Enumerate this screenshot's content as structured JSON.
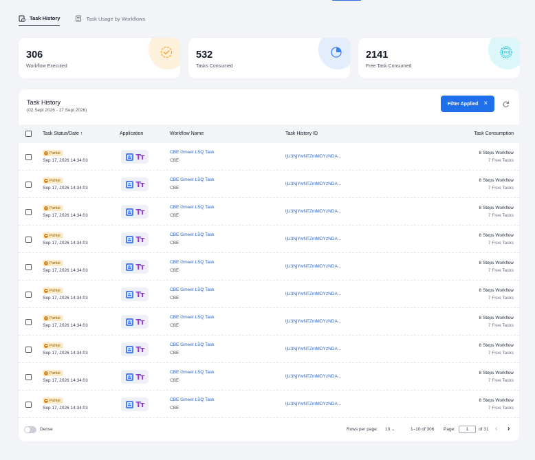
{
  "tabs": [
    {
      "label": "Task History",
      "icon": "history-icon",
      "active": true
    },
    {
      "label": "Task Usage by Workflows",
      "icon": "document-icon",
      "active": false
    }
  ],
  "kpis": [
    {
      "value": "306",
      "label": "Workflow Executed",
      "icon": "gear-check-icon",
      "color": "#f5a524"
    },
    {
      "value": "532",
      "label": "Tasks Consumed",
      "icon": "pie-chart-icon",
      "color": "#3b82f6"
    },
    {
      "value": "2141",
      "label": "Free Task Consumed",
      "icon": "free-badge-icon",
      "color": "#22c3d6"
    }
  ],
  "panel": {
    "title": "Task History",
    "subtitle": "(02 Sept 2026 - 17 Sept 2026)",
    "filter_label": "Filter Applied",
    "filter_clear": "×"
  },
  "columns": {
    "status": "Task Status/Date ↑",
    "application": "Application",
    "workflow": "Workflow Name",
    "history_id": "Task History ID",
    "consumption": "Task Consumption"
  },
  "rows": [
    {
      "status": "Partial",
      "date": "Sep 17, 2026 14:34:03",
      "app_cal": "31",
      "app_t": "Tт",
      "workflow": "CBE Gmeet LSQ Task",
      "workspace": "CBE",
      "history_id": "ljU3NjYwNTZmMDYzNDA...",
      "steps": "8 Steps Workflow",
      "free": "7 Free Tasks"
    },
    {
      "status": "Partial",
      "date": "Sep 17, 2026 14:34:03",
      "app_cal": "31",
      "app_t": "Tт",
      "workflow": "CBE Gmeet LSQ Task",
      "workspace": "CBE",
      "history_id": "ljU3NjYwNTZmMDYzNDA...",
      "steps": "8 Steps Workflow",
      "free": "7 Free Tasks"
    },
    {
      "status": "Partial",
      "date": "Sep 17, 2026 14:34:03",
      "app_cal": "31",
      "app_t": "Tт",
      "workflow": "CBE Gmeet LSQ Task",
      "workspace": "CBE",
      "history_id": "ljU3NjYwNTZmMDYzNDA...",
      "steps": "8 Steps Workflow",
      "free": "7 Free Tasks"
    },
    {
      "status": "Partial",
      "date": "Sep 17, 2026 14:34:03",
      "app_cal": "31",
      "app_t": "Tт",
      "workflow": "CBE Gmeet LSQ Task",
      "workspace": "CBE",
      "history_id": "ljU3NjYwNTZmMDYzNDA...",
      "steps": "8 Steps Workflow",
      "free": "7 Free Tasks"
    },
    {
      "status": "Partial",
      "date": "Sep 17, 2026 14:34:03",
      "app_cal": "31",
      "app_t": "Tт",
      "workflow": "CBE Gmeet LSQ Task",
      "workspace": "CBE",
      "history_id": "ljU3NjYwNTZmMDYzNDA...",
      "steps": "8 Steps Workflow",
      "free": "7 Free Tasks"
    },
    {
      "status": "Partial",
      "date": "Sep 17, 2026 14:34:03",
      "app_cal": "31",
      "app_t": "Tт",
      "workflow": "CBE Gmeet LSQ Task",
      "workspace": "CBE",
      "history_id": "ljU3NjYwNTZmMDYzNDA...",
      "steps": "8 Steps Workflow",
      "free": "7 Free Tasks"
    },
    {
      "status": "Partial",
      "date": "Sep 17, 2026 14:34:03",
      "app_cal": "31",
      "app_t": "Tт",
      "workflow": "CBE Gmeet LSQ Task",
      "workspace": "CBE",
      "history_id": "ljU3NjYwNTZmMDYzNDA...",
      "steps": "8 Steps Workflow",
      "free": "7 Free Tasks"
    },
    {
      "status": "Partial",
      "date": "Sep 17, 2026 14:34:03",
      "app_cal": "31",
      "app_t": "Tт",
      "workflow": "CBE Gmeet LSQ Task",
      "workspace": "CBE",
      "history_id": "ljU3NjYwNTZmMDYzNDA...",
      "steps": "8 Steps Workflow",
      "free": "7 Free Tasks"
    },
    {
      "status": "Partial",
      "date": "Sep 17, 2026 14:34:03",
      "app_cal": "31",
      "app_t": "Tт",
      "workflow": "CBE Gmeet LSQ Task",
      "workspace": "CBE",
      "history_id": "ljU3NjYwNTZmMDYzNDA...",
      "steps": "8 Steps Workflow",
      "free": "7 Free Tasks"
    },
    {
      "status": "Partial",
      "date": "Sep 17, 2026 14:34:03",
      "app_cal": "31",
      "app_t": "Tт",
      "workflow": "CBE Gmeet LSQ Task",
      "workspace": "CBE",
      "history_id": "ljU3NjYwNTZmMDYzNDA...",
      "steps": "8 Steps Workflow",
      "free": "7 Free Tasks"
    }
  ],
  "footer": {
    "dense_label": "Dense",
    "rows_per_page_label": "Rows per page:",
    "rows_per_page_value": "10 ⌄",
    "range": "1–10 of 306",
    "page_label": "Page:",
    "page_value": "1",
    "page_of": "of 31",
    "prev": "‹",
    "next": "›"
  },
  "colors": {
    "accent": "#1f6feb",
    "partial_badge": "#fdebc8",
    "link": "#2563c9"
  }
}
